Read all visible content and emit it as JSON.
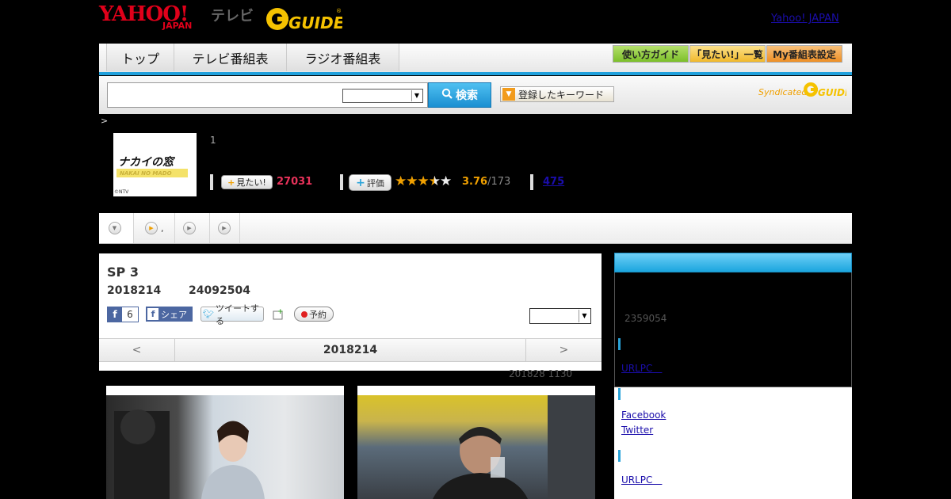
{
  "header": {
    "yahoo_logo": "YAHOO!",
    "yahoo_japan": "JAPAN",
    "terebi": "テレビ",
    "gguide_logo": "GGUIDE",
    "yahoo_japan_link": "Yahoo! JAPAN"
  },
  "nav": {
    "tabs": [
      {
        "label": "トップ"
      },
      {
        "label": "テレビ番組表"
      },
      {
        "label": "ラジオ番組表"
      }
    ],
    "buttons": [
      {
        "label": "使い方ガイド",
        "color": "#8fcc3a"
      },
      {
        "label": "「見たい!」一覧",
        "color": "#f6c23e"
      },
      {
        "label": "My番組表設定",
        "color": "#f29a2e"
      }
    ]
  },
  "search": {
    "input_value": "",
    "select_value": "",
    "button_label": "検索",
    "keyword_button_label": "登録したキーワード",
    "syndicated_label": "Syndicated",
    "syndicated_logo": "GGUIDE"
  },
  "breadcrumb": ">",
  "program": {
    "thumb_title": "ナカイの窓",
    "thumb_subtitle": "NAKAI NO MADO",
    "thumb_copyright": "©NTV",
    "number": "1",
    "mitai_label": "見たい!",
    "mitai_count": "27031",
    "hyoka_label": "評価",
    "rating": "3.76",
    "rating_total": "/173",
    "rating_stars": 3.76,
    "review_count": "475"
  },
  "subtabs": [
    {
      "label": ""
    },
    {
      "label": ","
    },
    {
      "label": ""
    },
    {
      "label": ""
    }
  ],
  "episode": {
    "title": "SP 3",
    "date": "2018214",
    "id": "24092504",
    "fb_like_count": "6",
    "fb_share_label": "シェア",
    "tweet_label": "ツイートする",
    "yoyaku_label": "予約",
    "select_value": "",
    "pager_prev": "<",
    "pager_date": "2018214",
    "pager_next": ">",
    "updated": "201828  1130"
  },
  "sidebar": {
    "number": "2359054",
    "url_link_1": "URLPC　",
    "facebook_link": "Facebook",
    "twitter_link": "Twitter",
    "url_link_2": "URLPC　"
  },
  "colors": {
    "accent_blue": "#1fa0dc",
    "mitai_red": "#e8325a",
    "rating_orange": "#f0a000",
    "link_blue": "#1a0dab"
  }
}
